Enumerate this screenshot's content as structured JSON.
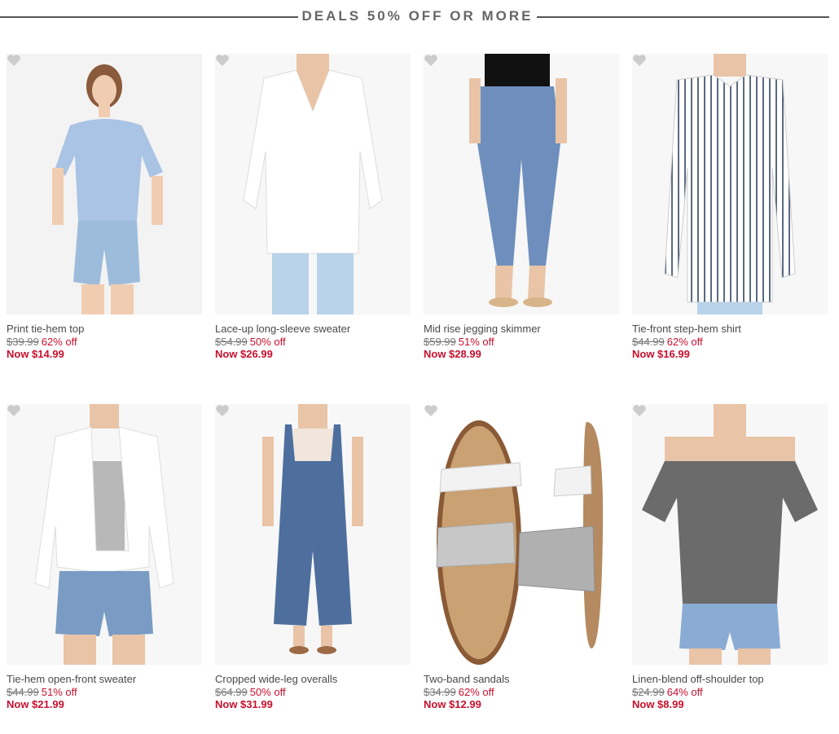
{
  "header": {
    "title": "DEALS 50% OFF OR MORE"
  },
  "colors": {
    "accent": "#c8102e",
    "text": "#555555",
    "heart": "#cccccc"
  },
  "products": [
    {
      "name": "Print tie-hem top",
      "was": "$39.99",
      "off": "62% off",
      "now": "Now $14.99",
      "icon": "heart-icon"
    },
    {
      "name": "Lace-up long-sleeve sweater",
      "was": "$54.99",
      "off": "50% off",
      "now": "Now $26.99",
      "icon": "heart-icon"
    },
    {
      "name": "Mid rise jegging skimmer",
      "was": "$59.99",
      "off": "51% off",
      "now": "Now $28.99",
      "icon": "heart-icon"
    },
    {
      "name": "Tie-front step-hem shirt",
      "was": "$44.99",
      "off": "62% off",
      "now": "Now $16.99",
      "icon": "heart-icon"
    },
    {
      "name": "Tie-hem open-front sweater",
      "was": "$44.99",
      "off": "51% off",
      "now": "Now $21.99",
      "icon": "heart-icon"
    },
    {
      "name": "Cropped wide-leg overalls",
      "was": "$64.99",
      "off": "50% off",
      "now": "Now $31.99",
      "icon": "heart-icon"
    },
    {
      "name": "Two-band sandals",
      "was": "$34.99",
      "off": "62% off",
      "now": "Now $12.99",
      "icon": "heart-icon"
    },
    {
      "name": "Linen-blend off-shoulder top",
      "was": "$24.99",
      "off": "64% off",
      "now": "Now $8.99",
      "icon": "heart-icon"
    }
  ]
}
